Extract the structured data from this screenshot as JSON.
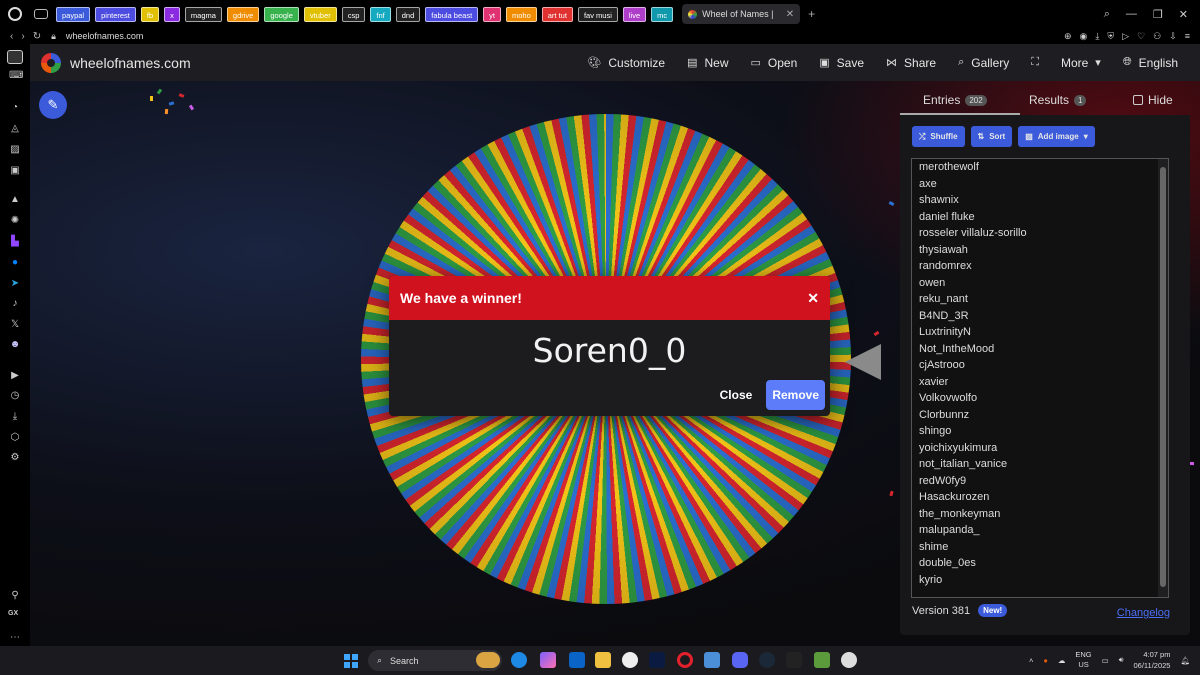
{
  "browser": {
    "bookmarks": [
      {
        "label": "paypal",
        "color": "#3b5bdb"
      },
      {
        "label": "pinterest",
        "color": "#4c4ce0"
      },
      {
        "label": "fb",
        "color": "#e0c000"
      },
      {
        "label": "x",
        "color": "#8a2be2"
      },
      {
        "label": "magma",
        "color": "#222222"
      },
      {
        "label": "gdrive",
        "color": "#f08c00"
      },
      {
        "label": "google",
        "color": "#37b24d"
      },
      {
        "label": "vtuber",
        "color": "#e0c000"
      },
      {
        "label": "csp",
        "color": "#222222"
      },
      {
        "label": "fnf",
        "color": "#15aabf"
      },
      {
        "label": "dnd",
        "color": "#222222"
      },
      {
        "label": "fabula beast",
        "color": "#4c4ce0"
      },
      {
        "label": "yt",
        "color": "#e03170"
      },
      {
        "label": "moho",
        "color": "#f08c00"
      },
      {
        "label": "art tut",
        "color": "#e03131"
      },
      {
        "label": "fav musi",
        "color": "#222222"
      },
      {
        "label": "live",
        "color": "#ae3ec9"
      },
      {
        "label": "mc",
        "color": "#1098ad"
      }
    ],
    "active_tab": "Wheel of Names |",
    "url": "wheelofnames.com"
  },
  "header": {
    "site_title": "wheelofnames.com",
    "menu": [
      {
        "label": "Customize",
        "icon": "palette-icon"
      },
      {
        "label": "New",
        "icon": "file-icon"
      },
      {
        "label": "Open",
        "icon": "folder-icon"
      },
      {
        "label": "Save",
        "icon": "floppy-icon"
      },
      {
        "label": "Share",
        "icon": "share-icon"
      },
      {
        "label": "Gallery",
        "icon": "search-icon"
      },
      {
        "label": "",
        "icon": "fullscreen-icon"
      },
      {
        "label": "More",
        "icon": "chevron-down-icon"
      },
      {
        "label": "English",
        "icon": "globe-icon"
      }
    ]
  },
  "modal": {
    "title": "We have a winner!",
    "winner": "Soren0_0",
    "close_label": "Close",
    "remove_label": "Remove"
  },
  "panel": {
    "entries_tab": "Entries",
    "entries_count": "202",
    "results_tab": "Results",
    "results_count": "1",
    "hide_label": "Hide",
    "shuffle_label": "Shuffle",
    "sort_label": "Sort",
    "add_image_label": "Add image",
    "entries": [
      "merothewolf",
      "axe",
      "shawnix",
      "daniel fluke",
      "rosseler villaluz-sorillo",
      "thysiawah",
      "randomrex",
      "owen",
      "reku_nant",
      "B4ND_3R",
      "LuxtrinityN",
      "Not_IntheMood",
      "cjAstrooo",
      "xavier",
      "Volkovwolfo",
      "Clorbunnz",
      "shingo",
      "yoichixyukimura",
      "not_italian_vanice",
      "redW0fy9",
      "Hasackurozen",
      "the_monkeyman",
      "malupanda_",
      "shime",
      "double_0es",
      "kyrio"
    ],
    "version_label": "Version 381",
    "new_badge": "New!",
    "changelog_label": "Changelog"
  },
  "taskbar": {
    "search_label": "Search",
    "lang_top": "ENG",
    "lang_bottom": "US",
    "time": "4:07 pm",
    "date": "06/11/2025"
  },
  "colors": {
    "winner_header": "#d0121f",
    "accent": "#3b5bdb",
    "wheel": [
      "#2b6fd1",
      "#2f9e44",
      "#f2c418",
      "#d8262f"
    ]
  }
}
